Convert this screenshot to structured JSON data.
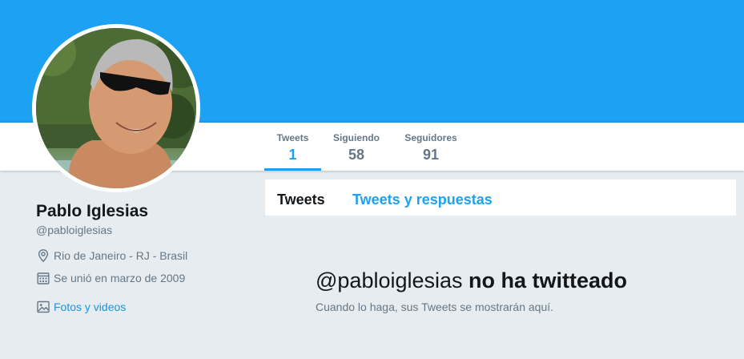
{
  "colors": {
    "banner": "#1da1f2",
    "accent": "#1da1f2",
    "link": "#1b95e0",
    "background": "#e6ecf0",
    "muted_text": "#657786",
    "primary_text": "#14171a"
  },
  "nav": {
    "stats": [
      {
        "label": "Tweets",
        "value": "1",
        "active": true
      },
      {
        "label": "Siguiendo",
        "value": "58",
        "active": false
      },
      {
        "label": "Seguidores",
        "value": "91",
        "active": false
      }
    ]
  },
  "profile": {
    "name": "Pablo Iglesias",
    "handle": "@pabloiglesias",
    "location": "Rio de Janeiro - RJ - Brasil",
    "joined": "Se unió en marzo de 2009",
    "photos_link": "Fotos y videos",
    "avatar_icon": "profile-photo"
  },
  "icons": {
    "location": "location-pin-icon",
    "joined": "calendar-icon",
    "photos": "image-icon"
  },
  "timeline": {
    "tabs": [
      {
        "label": "Tweets",
        "active": true
      },
      {
        "label": "Tweets y respuestas",
        "active": false
      }
    ],
    "empty_handle": "@pabloiglesias",
    "empty_title_rest": "no ha twitteado",
    "empty_subtitle": "Cuando lo haga, sus Tweets se mostrarán aquí."
  }
}
